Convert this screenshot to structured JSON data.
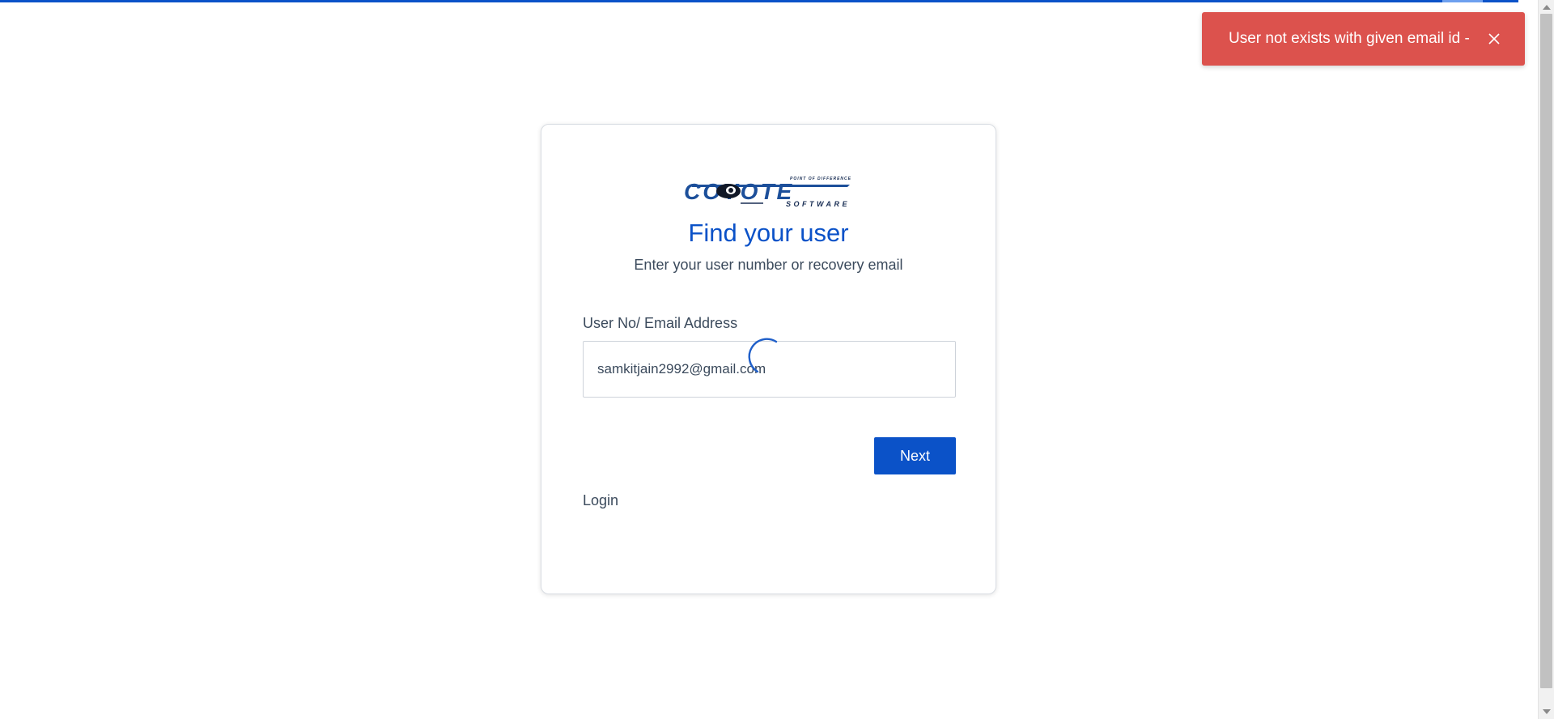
{
  "toast": {
    "message": "User not exists with given email id -",
    "close_icon": "close-icon",
    "color": "#dc524d"
  },
  "brand": {
    "logo_text": "COYOTE",
    "logo_subtext": "SOFTWARE",
    "logo_tagline": "POINT OF DIFFERENCE",
    "accent_color": "#0b52c8"
  },
  "card": {
    "title": "Find your user",
    "subtitle": "Enter your user number or recovery email",
    "field": {
      "label": "User No/ Email Address",
      "value": "samkitjain2992@gmail.com",
      "placeholder": ""
    },
    "next_label": "Next",
    "login_label": "Login",
    "loading_icon": "spinner-icon"
  }
}
